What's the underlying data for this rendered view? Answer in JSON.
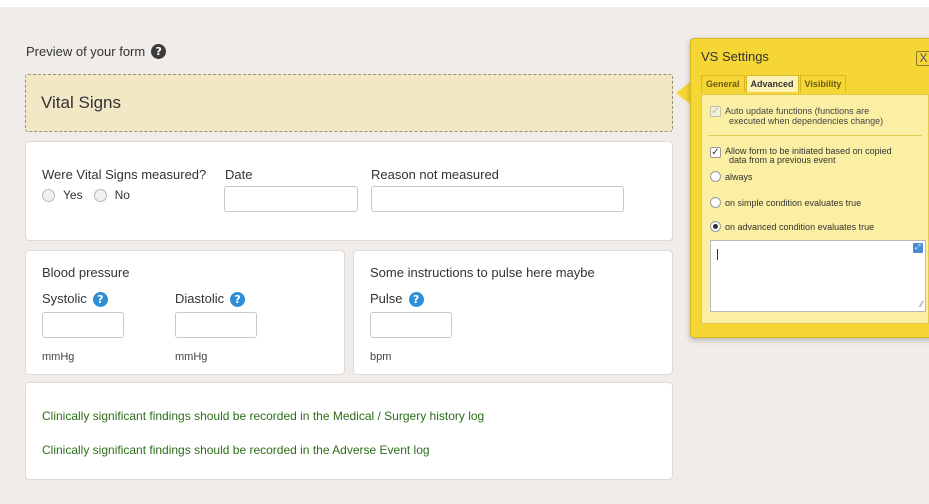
{
  "preview": {
    "title": "Preview of your form",
    "help_glyph": "?"
  },
  "section": {
    "title": "Vital Signs"
  },
  "vitals": {
    "measured_label": "Were Vital Signs measured?",
    "yes_label": "Yes",
    "no_label": "No",
    "date_label": "Date",
    "date_value": "",
    "reason_label": "Reason not measured",
    "reason_value": ""
  },
  "blood_pressure": {
    "title": "Blood pressure",
    "systolic_label": "Systolic",
    "diastolic_label": "Diastolic",
    "systolic_value": "",
    "diastolic_value": "",
    "systolic_unit": "mmHg",
    "diastolic_unit": "mmHg",
    "help_glyph": "?"
  },
  "pulse": {
    "instructions": "Some instructions to pulse here maybe",
    "label": "Pulse",
    "value": "",
    "unit": "bpm",
    "help_glyph": "?"
  },
  "notes": {
    "line1": "Clinically significant findings should be recorded in the Medical / Surgery history log",
    "line2": "Clinically significant findings should be recorded in the Adverse Event log"
  },
  "settings": {
    "title": "VS Settings",
    "close_glyph": "X",
    "tabs": [
      {
        "label": "General",
        "active": false
      },
      {
        "label": "Advanced",
        "active": true
      },
      {
        "label": "Visibility",
        "active": false
      }
    ],
    "auto_update": {
      "line1": "Auto update functions (functions are",
      "line2": "executed when dependencies change)",
      "checked": true,
      "disabled": true
    },
    "allow_init": {
      "line1": "Allow form to be initiated based on copied",
      "line2": "data from a previous event",
      "checked": true
    },
    "options": [
      {
        "label": "always",
        "selected": false
      },
      {
        "label": "on simple condition evaluates true",
        "selected": false
      },
      {
        "label": "on advanced condition evaluates true",
        "selected": true
      }
    ],
    "condition_text": ""
  },
  "icons": {
    "help": "help-circle-icon",
    "close": "close-icon",
    "expand": "expand-editor-icon",
    "resize": "resize-handle-icon"
  },
  "colors": {
    "background": "#efece9",
    "section_fill": "#f2e8c6",
    "panel_yellow": "#f5d635",
    "help_blue": "#2e8fd8",
    "note_green": "#2c6e1a"
  }
}
